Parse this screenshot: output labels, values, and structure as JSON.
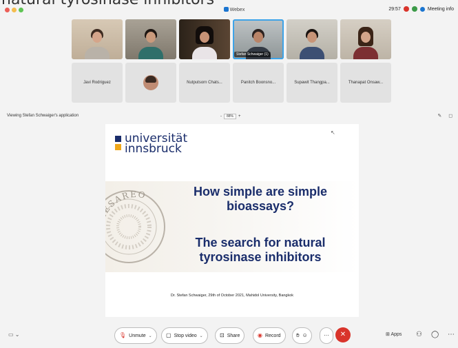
{
  "overlay_caption": "natural tyrosinase inhibitors",
  "window": {
    "app_title": "Webex",
    "time": "29:57",
    "meeting_info": "Meeting info"
  },
  "participants_video": [
    {
      "name": ""
    },
    {
      "name": ""
    },
    {
      "name": ""
    },
    {
      "name": "Stefan Schwaiger",
      "badge": "(1)"
    },
    {
      "name": ""
    },
    {
      "name": ""
    }
  ],
  "participants_names": [
    "Javi Rodriguez",
    "",
    "Nutputsorn Chats...",
    "Panitch Boonsno...",
    "Supawit Thangpa...",
    "Thanapat Onsaw..."
  ],
  "share_bar": {
    "viewing_label": "Viewing Stefan Schwaiger's application",
    "zoom": "88%",
    "zoom_minus": "-",
    "zoom_plus": "+"
  },
  "slide": {
    "logo_line1": "universität",
    "logo_line2": "innsbruck",
    "seal_text": "CAESAREO",
    "title_line1": "How simple are simple",
    "title_line2": "bioassays?",
    "subtitle_line1": "The search for natural",
    "subtitle_line2": "tyrosinase inhibitors",
    "footer": "Dr. Stefan Schwaiger, 29th of October 2021, Mahidol University, Bangkok"
  },
  "toolbar": {
    "unmute": "Unmute",
    "stop_video": "Stop video",
    "share": "Share",
    "record": "Record",
    "apps": "Apps"
  },
  "colors": {
    "accent": "#1a2d6b",
    "brand_orange": "#f0a81c",
    "end_red": "#d9342b",
    "webex_blue": "#1b75d0"
  }
}
